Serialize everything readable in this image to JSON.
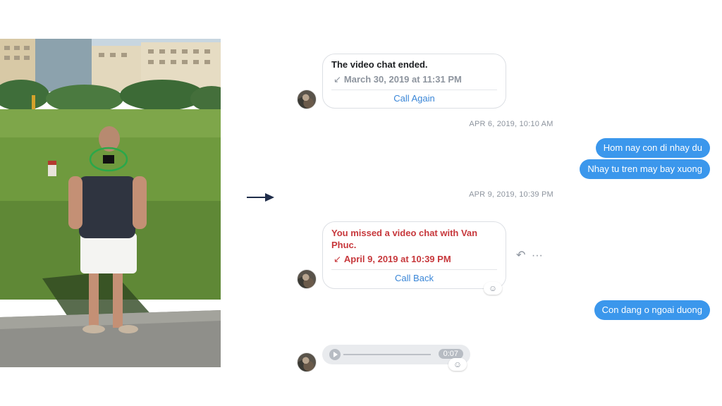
{
  "video_chat_card": {
    "title": "The video chat ended.",
    "time": "March 30, 2019 at 11:31 PM",
    "time_icon": "↙",
    "action": "Call Again"
  },
  "timestamps": {
    "first": "APR 6, 2019, 10:10 AM",
    "second": "APR 9, 2019, 10:39 PM"
  },
  "outgoing_messages": [
    "Hom nay con di nhay du",
    "Nhay tu tren may bay xuong",
    "Con dang o ngoai duong"
  ],
  "missed_chat_card": {
    "title_line1": "You missed a video chat with Van",
    "title_line2": "Phuc.",
    "time": "April 9, 2019 at 10:39 PM",
    "time_icon": "↙",
    "action": "Call Back"
  },
  "audio_message": {
    "duration": "0:07"
  },
  "icons": {
    "reaction": "☺",
    "reply": "↶",
    "more": "···"
  },
  "colors": {
    "bubble": "#3b97ec",
    "missed": "#c7383c",
    "link": "#3a86d7"
  }
}
